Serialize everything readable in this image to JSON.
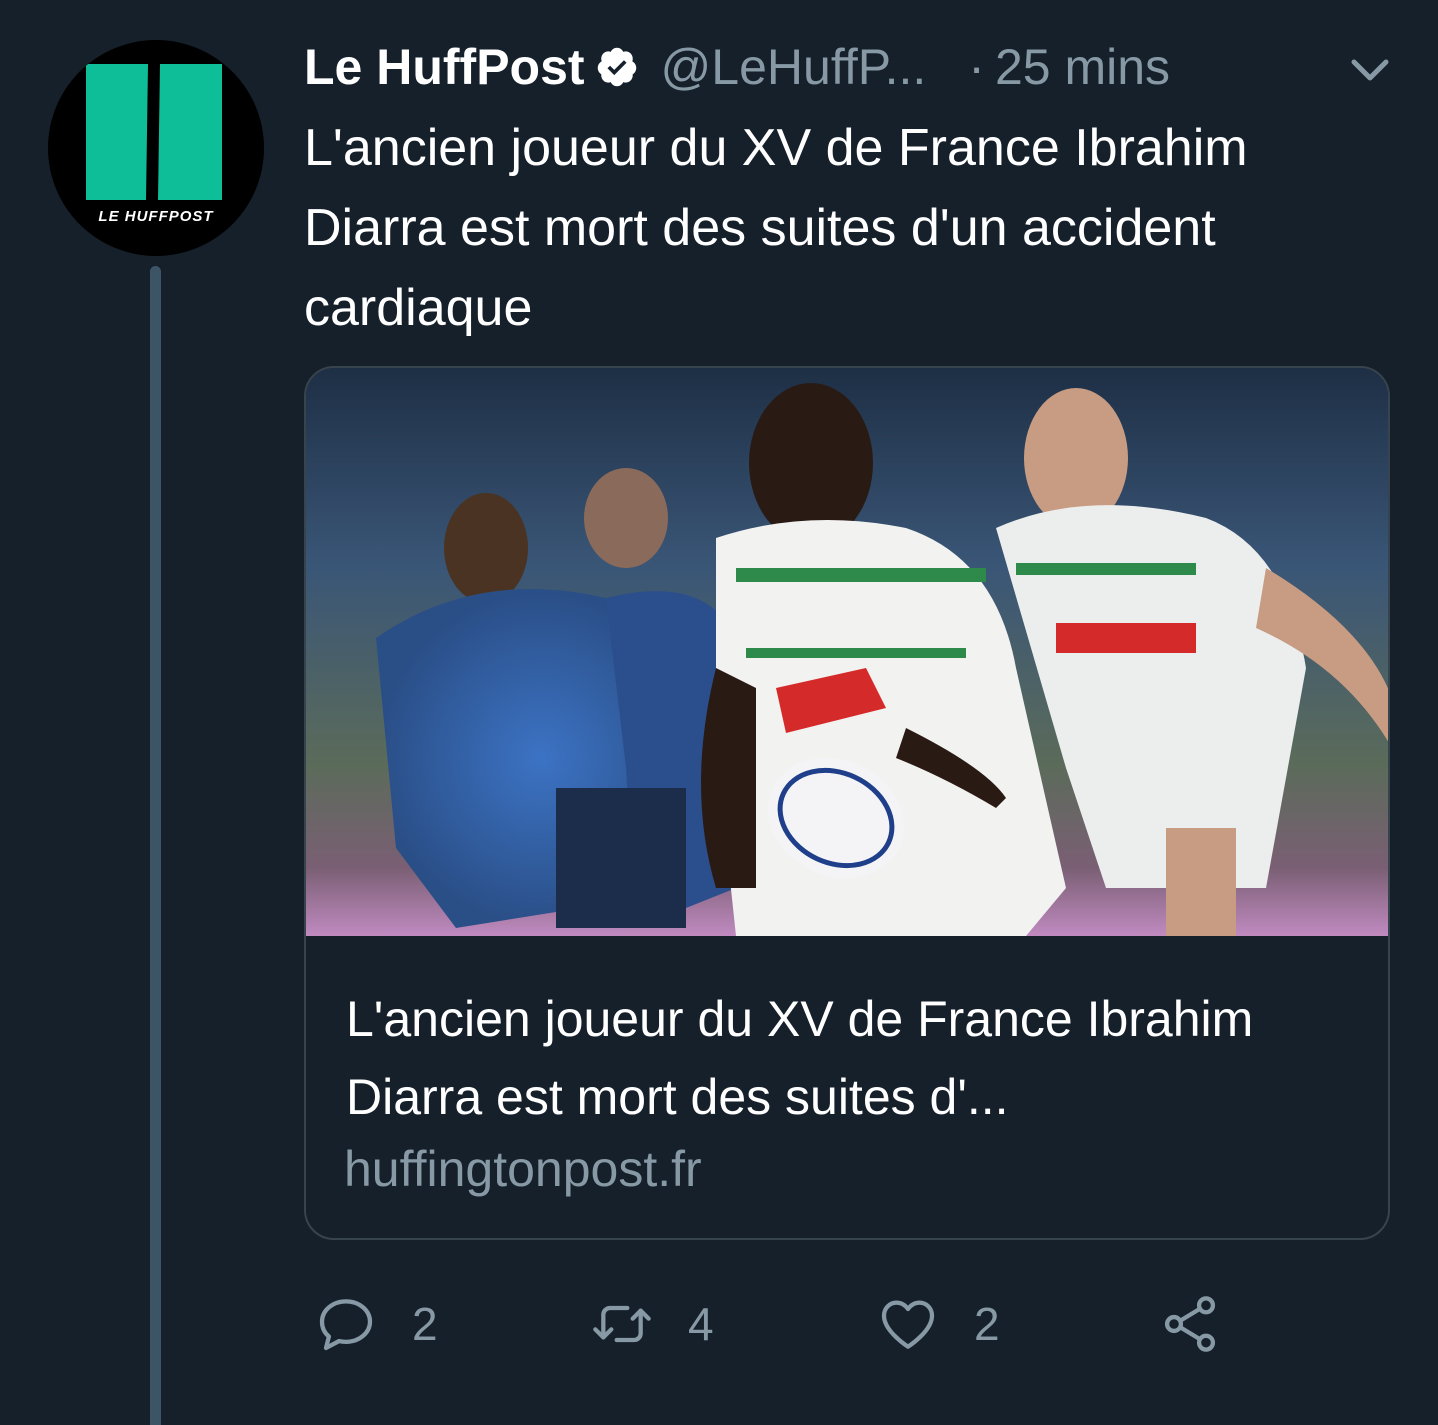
{
  "tweet": {
    "author_name": "Le HuffPost",
    "handle": "@LeHuffP...",
    "separator": "·",
    "time": "25 mins",
    "avatar_text": "LE HUFFPOST",
    "text": "L'ancien joueur du XV de France Ibrahim Diarra est mort des suites d'un accident cardiaque"
  },
  "card": {
    "title": "L'ancien joueur du XV de France Ibrahim Diarra est mort des suites d'...",
    "domain": "huffingtonpost.fr"
  },
  "actions": {
    "reply_count": "2",
    "retweet_count": "4",
    "like_count": "2"
  },
  "colors": {
    "background": "#15202b",
    "secondary_text": "#8899a6",
    "border": "#38444d",
    "brand_green": "#0dbe98"
  },
  "icons": [
    "verified-icon",
    "chevron-down-icon",
    "reply-icon",
    "retweet-icon",
    "like-icon",
    "share-icon"
  ]
}
